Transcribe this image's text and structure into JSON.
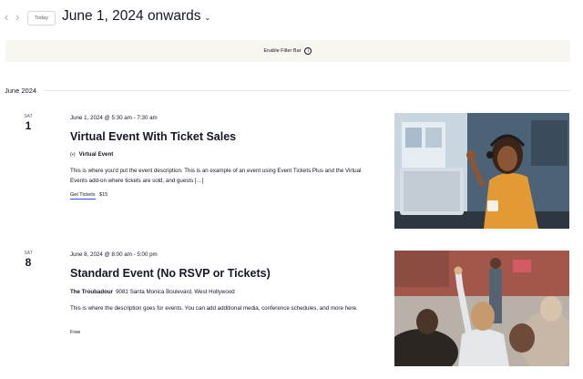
{
  "header": {
    "prev_icon": "chevron-left-icon",
    "prev_glyph": "‹",
    "next_icon": "chevron-right-icon",
    "next_glyph": "›",
    "today_label": "Today",
    "date_range": "June 1, 2024 onwards",
    "dropdown_icon": "chevron-down-icon",
    "dropdown_glyph": "⌄"
  },
  "filter_bar": {
    "label": "Enable Filter Bar",
    "info_icon": "info-icon",
    "info_glyph": "i"
  },
  "month": {
    "label": "June 2024"
  },
  "events": [
    {
      "day_of_week": "SAT",
      "day": "1",
      "datetime": "June 1, 2024 @ 5:30 am - 7:30 am",
      "title": "Virtual Event With Ticket Sales",
      "venue_icon": "virtual-event-icon",
      "venue_glyph": "(•)",
      "venue": "Virtual Event",
      "venue_address": "",
      "description": "This is where you'd put the event description. This is an example of an event using Event Tickets Plus and the Virtual Events add-on where tickets are sold, and guests […]",
      "cta_label": "Get Tickets",
      "price": "$15",
      "image": "woman-waving-at-laptop-photo"
    },
    {
      "day_of_week": "SAT",
      "day": "8",
      "datetime": "June 8, 2024 @ 8:00 am - 5:00 pm",
      "title": "Standard Event (No RSVP or Tickets)",
      "venue": "The Troubadour",
      "venue_address": "9081 Santa Monica Boulevard, West Hollywood",
      "description": "This is where the description goes for events. You can add additional media, conference schedules, and more here.",
      "price": "Free",
      "image": "audience-raising-hand-photo"
    }
  ],
  "colors": {
    "text": "#141827",
    "muted": "#5d5d5d",
    "filter_bg": "#f7f6f0",
    "link_underline": "#334aff",
    "divider": "#e4e4e4"
  }
}
